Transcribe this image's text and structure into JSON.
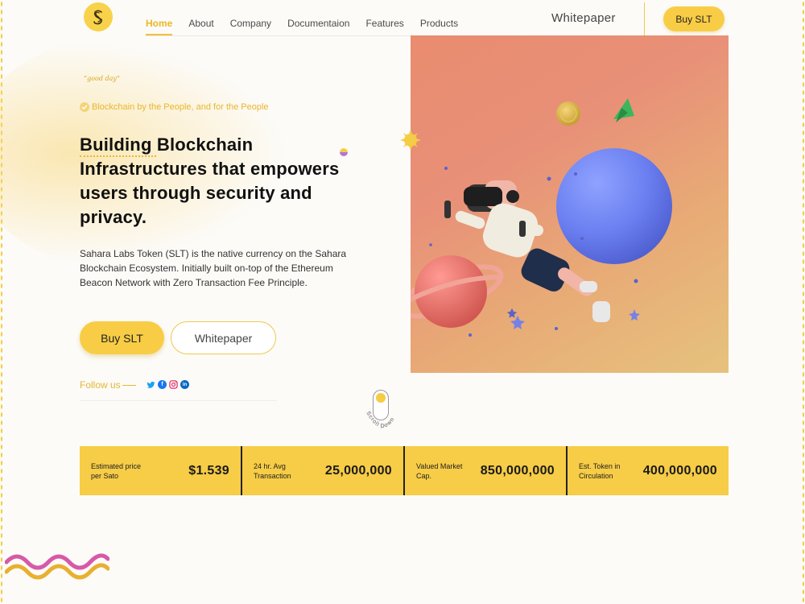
{
  "nav": {
    "items": [
      {
        "label": "Home",
        "active": true
      },
      {
        "label": "About"
      },
      {
        "label": "Company"
      },
      {
        "label": "Documentaion"
      },
      {
        "label": "Features"
      },
      {
        "label": "Products"
      }
    ],
    "whitepaper_label": "Whitepaper",
    "buy_label": "Buy SLT"
  },
  "hero": {
    "greeting": "“good day”",
    "tagline": "Blockchain by the People, and for the People",
    "title": "Building Blockchain Infrastructures that empowers users through security and privacy.",
    "description": "Sahara Labs Token (SLT) is the native currency on the Sahara Blockchain Ecosystem. Initially built on-top of the Ethereum Beacon Network with Zero Transaction Fee Principle.",
    "buy_button": "Buy SLT",
    "whitepaper_button": "Whitepaper",
    "follow_label": "Follow us",
    "socials": [
      "twitter-icon",
      "facebook-icon",
      "instagram-icon",
      "linkedin-icon"
    ],
    "scroll_label": "Scroll Down"
  },
  "stats": [
    {
      "label": "Estimated price per Sato",
      "value": "$1.539"
    },
    {
      "label": "24 hr. Avg Transaction",
      "value": "25,000,000"
    },
    {
      "label": "Valued Market Cap.",
      "value": "850,000,000"
    },
    {
      "label": "Est. Token in Circulation",
      "value": "400,000,000"
    }
  ],
  "colors": {
    "accent": "#f8cd45",
    "accent_text": "#e9b62c",
    "dark": "#151515"
  }
}
